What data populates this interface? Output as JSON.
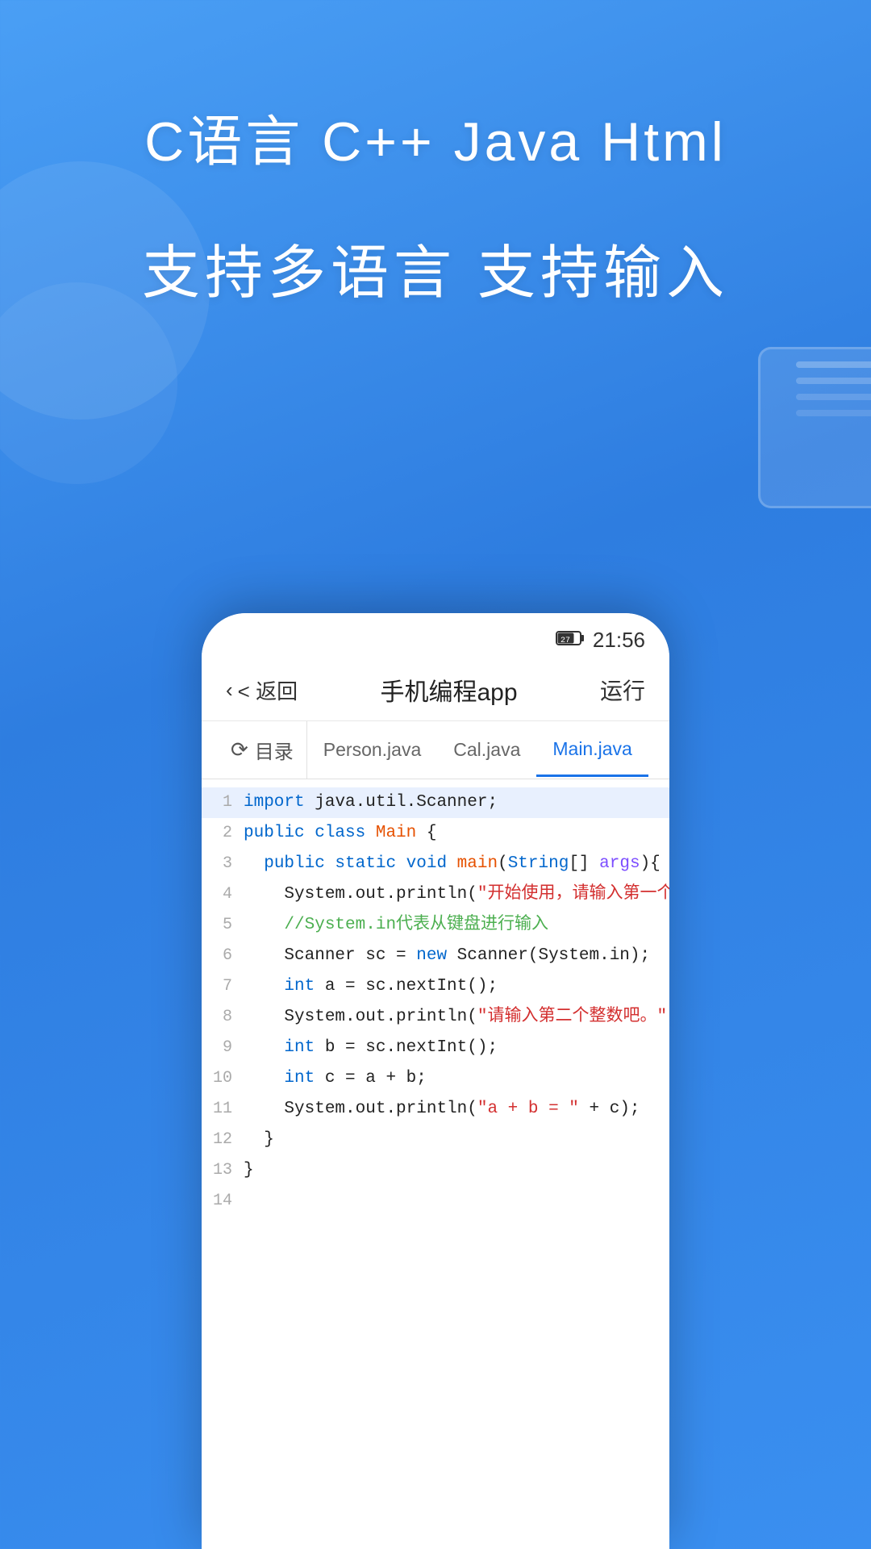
{
  "hero": {
    "title": "C语言  C++  Java  Html",
    "subtitle": "支持多语言  支持输入"
  },
  "phone": {
    "status": {
      "battery": "27",
      "time": "21:56"
    },
    "header": {
      "back_label": "< 返回",
      "title": "手机编程app",
      "run_label": "运行"
    },
    "tabs": [
      {
        "label": "目录",
        "icon": "↺",
        "active": false
      },
      {
        "label": "Person.java",
        "active": false
      },
      {
        "label": "Cal.java",
        "active": false
      },
      {
        "label": "Main.java",
        "active": true
      }
    ],
    "code_lines": [
      {
        "num": "1",
        "content": "import java.util.Scanner;"
      },
      {
        "num": "2",
        "content": "public class Main {"
      },
      {
        "num": "3",
        "content": "   public static void main(String[] args){"
      },
      {
        "num": "4",
        "content": "      System.out.println(\"开始使用，请输入第一个整数吧。\");"
      },
      {
        "num": "5",
        "content": "      //System.in代表从键盘进行输入"
      },
      {
        "num": "6",
        "content": "      Scanner sc = new Scanner(System.in);"
      },
      {
        "num": "7",
        "content": "      int a = sc.nextInt();"
      },
      {
        "num": "8",
        "content": "      System.out.println(\"请输入第二个整数吧。\");"
      },
      {
        "num": "9",
        "content": "      int b = sc.nextInt();"
      },
      {
        "num": "10",
        "content": "      int c = a + b;"
      },
      {
        "num": "11",
        "content": "      System.out.println(\"a + b = \" + c);"
      },
      {
        "num": "12",
        "content": "   }"
      },
      {
        "num": "13",
        "content": "}"
      },
      {
        "num": "14",
        "content": ""
      }
    ]
  }
}
